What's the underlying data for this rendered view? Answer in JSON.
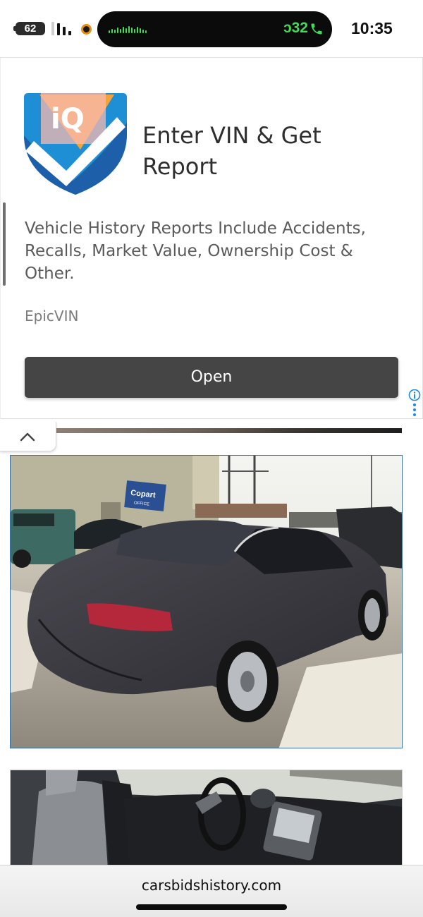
{
  "status_bar": {
    "battery_level": "62",
    "call_timer": "ↄ32",
    "time": "10:35",
    "icons": [
      "battery-icon",
      "signal-icon",
      "recording-indicator-icon",
      "audio-waveform-icon",
      "phone-icon"
    ]
  },
  "ad": {
    "logo_text": "iQ",
    "title": "Enter VIN & Get Report",
    "body": "Vehicle History Reports Include Accidents, Recalls, Market Value, Ownership Cost & Other.",
    "advertiser": "EpicVIN",
    "cta_label": "Open",
    "icons": [
      "epicvin-logo-icon",
      "adchoices-info-icon"
    ],
    "colors": {
      "cta": "#454545",
      "logo_blue": "#1e8fd4",
      "logo_dark_blue": "#1d5fa8",
      "logo_orange": "#f2a23a"
    }
  },
  "gallery": {
    "collapse_icon": "chevron-up-icon",
    "photo_1_sign": "Copart OFFICE",
    "photos": [
      "car-exterior-rear-photo",
      "car-interior-dashboard-photo"
    ]
  },
  "browser": {
    "url": "carsbidshistory.com"
  }
}
